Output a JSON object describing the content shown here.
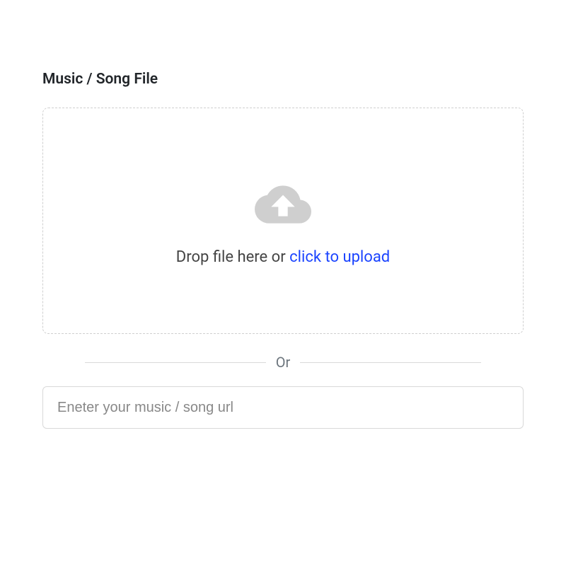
{
  "section": {
    "label": "Music / Song File"
  },
  "dropzone": {
    "prompt_prefix": "Drop file here or ",
    "prompt_link": "click to upload",
    "icon": "cloud-upload-icon"
  },
  "divider": {
    "label": "Or"
  },
  "url_input": {
    "placeholder": "Eneter your music / song url",
    "value": ""
  }
}
